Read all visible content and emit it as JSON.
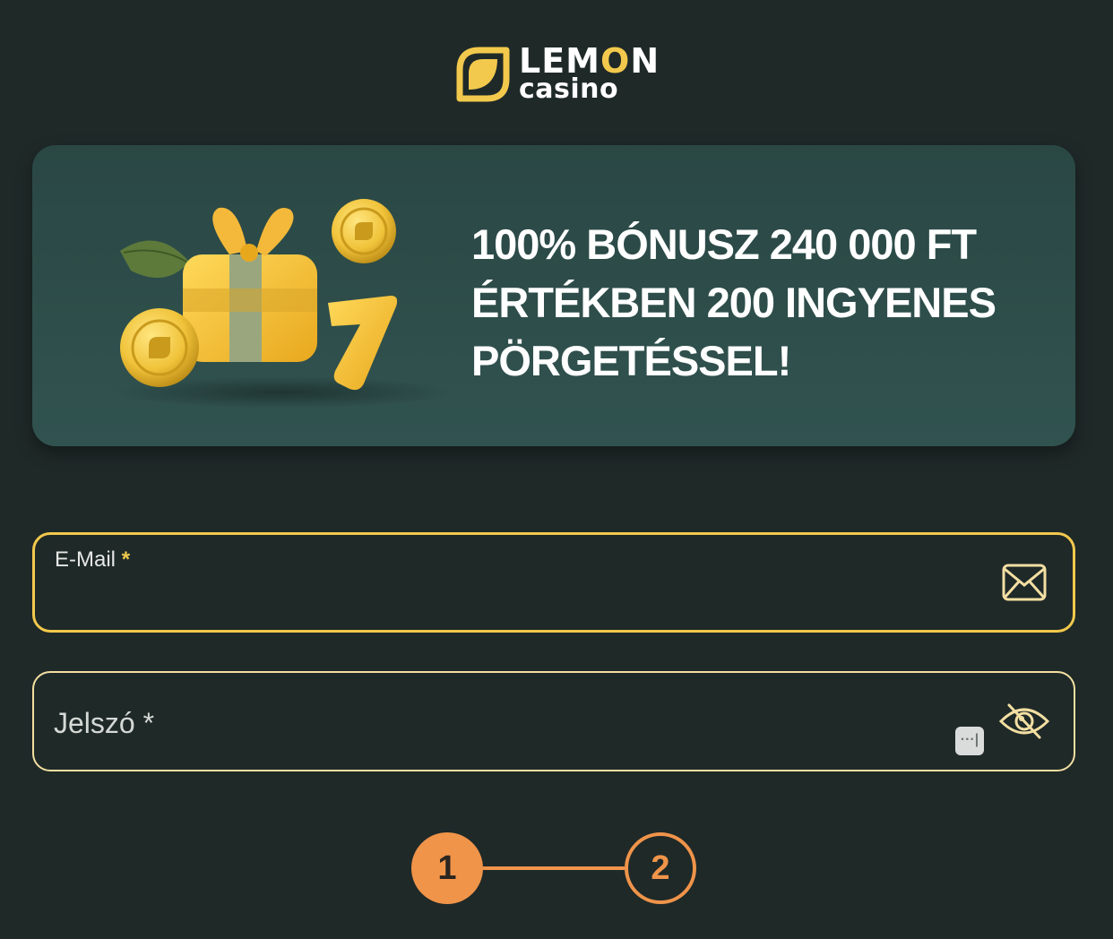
{
  "logo": {
    "word_a": "LEM",
    "word_o": "O",
    "word_b": "N",
    "sub": "casino"
  },
  "banner": {
    "title": "100% BÓNUSZ 240 000 FT ÉRTÉKBEN 200 INGYENES PÖRGETÉSSEL!"
  },
  "email": {
    "label": "E-Mail",
    "required_mark": "*",
    "value": ""
  },
  "password": {
    "label": "Jelszó *",
    "value": "",
    "manager_glyph": "···|"
  },
  "stepper": {
    "steps": [
      "1",
      "2"
    ],
    "current": 1
  },
  "colors": {
    "background": "#1f2928",
    "accent": "#f2c94c",
    "step": "#f0944a",
    "banner": "#2e4d4a"
  }
}
